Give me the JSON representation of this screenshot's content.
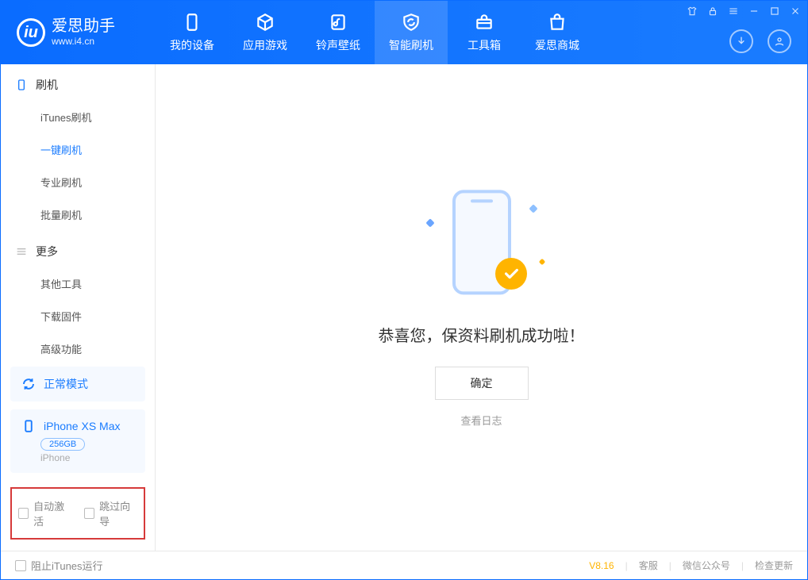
{
  "header": {
    "logo_title": "爱思助手",
    "logo_sub": "www.i4.cn",
    "tabs": [
      {
        "label": "我的设备"
      },
      {
        "label": "应用游戏"
      },
      {
        "label": "铃声壁纸"
      },
      {
        "label": "智能刷机"
      },
      {
        "label": "工具箱"
      },
      {
        "label": "爱思商城"
      }
    ]
  },
  "sidebar": {
    "group1": {
      "title": "刷机",
      "items": [
        {
          "label": "iTunes刷机"
        },
        {
          "label": "一键刷机"
        },
        {
          "label": "专业刷机"
        },
        {
          "label": "批量刷机"
        }
      ]
    },
    "group2": {
      "title": "更多",
      "items": [
        {
          "label": "其他工具"
        },
        {
          "label": "下载固件"
        },
        {
          "label": "高级功能"
        }
      ]
    },
    "mode_card": {
      "label": "正常模式"
    },
    "device_card": {
      "name": "iPhone XS Max",
      "capacity": "256GB",
      "type": "iPhone"
    },
    "checkboxes": {
      "auto_activate": "自动激活",
      "skip_guide": "跳过向导"
    }
  },
  "main": {
    "success_text": "恭喜您，保资料刷机成功啦！",
    "ok_button": "确定",
    "view_log": "查看日志"
  },
  "footer": {
    "block_itunes": "阻止iTunes运行",
    "version": "V8.16",
    "links": {
      "support": "客服",
      "wechat": "微信公众号",
      "update": "检查更新"
    }
  }
}
